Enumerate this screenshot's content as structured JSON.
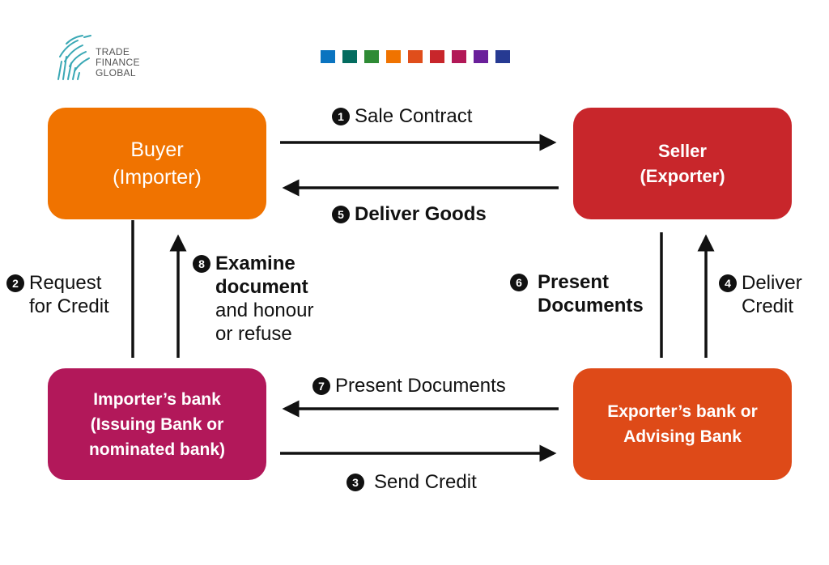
{
  "logo": {
    "lines": [
      "TRADE",
      "FINANCE",
      "GLOBAL"
    ],
    "icon": "fingerprint-swirl-icon",
    "color": "#3aa8b5"
  },
  "palette": [
    "#0a74c0",
    "#036c5f",
    "#2e8b35",
    "#f07300",
    "#e04e1b",
    "#c8262b",
    "#b21857",
    "#6a1f9a",
    "#263a92"
  ],
  "nodes": {
    "buyer": {
      "lines": [
        "Buyer",
        "(Importer)"
      ],
      "color": "#f07300"
    },
    "seller": {
      "lines": [
        "Seller",
        "(Exporter)"
      ],
      "color": "#c8262b"
    },
    "importers_bank": {
      "lines": [
        "Importer’s bank",
        "(Issuing Bank or",
        "nominated bank)"
      ],
      "color": "#b2185a"
    },
    "exporters_bank": {
      "lines": [
        "Exporter’s bank or",
        "Advising Bank"
      ],
      "color": "#de4a18"
    }
  },
  "steps": [
    {
      "num": "1",
      "lines": [
        "Sale Contract"
      ],
      "bold": false,
      "from": "buyer",
      "to": "seller"
    },
    {
      "num": "2",
      "lines": [
        "Request",
        "for Credit"
      ],
      "bold": false,
      "from": "buyer",
      "to": "importers_bank"
    },
    {
      "num": "3",
      "lines": [
        "Send Credit"
      ],
      "bold": false,
      "from": "importers_bank",
      "to": "exporters_bank"
    },
    {
      "num": "4",
      "lines": [
        "Deliver",
        "Credit"
      ],
      "bold": false,
      "from": "exporters_bank",
      "to": "seller"
    },
    {
      "num": "5",
      "lines": [
        "Deliver Goods"
      ],
      "bold": true,
      "from": "seller",
      "to": "buyer"
    },
    {
      "num": "6",
      "lines": [
        "Present",
        "Documents"
      ],
      "bold": true,
      "from": "seller",
      "to": "exporters_bank"
    },
    {
      "num": "7",
      "lines": [
        "Present Documents"
      ],
      "bold": false,
      "from": "exporters_bank",
      "to": "importers_bank"
    },
    {
      "num": "8",
      "lines_bold": [
        "Examine",
        "document"
      ],
      "lines": [
        "and honour",
        "or refuse"
      ],
      "from": "importers_bank",
      "to": "buyer"
    }
  ]
}
